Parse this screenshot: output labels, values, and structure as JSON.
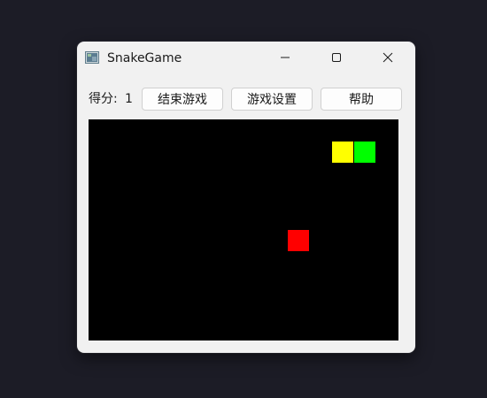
{
  "window": {
    "title": "SnakeGame"
  },
  "toolbar": {
    "score_label": "得分:",
    "score_value": "1",
    "end_game_label": "结束游戏",
    "settings_label": "游戏设置",
    "help_label": "帮助"
  },
  "board": {
    "background": "#000000",
    "grid_columns": 14,
    "grid_rows": 10,
    "snake": [
      {
        "col": 11,
        "row": 1,
        "part": "head",
        "color": "#ffff00"
      },
      {
        "col": 12,
        "row": 1,
        "part": "body",
        "color": "#00ff00"
      }
    ],
    "food": {
      "col": 9,
      "row": 5,
      "color": "#ff0000"
    }
  },
  "icons": {
    "app": "snake-game-app-icon",
    "minimize": "minimize-icon",
    "maximize": "maximize-icon",
    "close": "close-icon"
  }
}
